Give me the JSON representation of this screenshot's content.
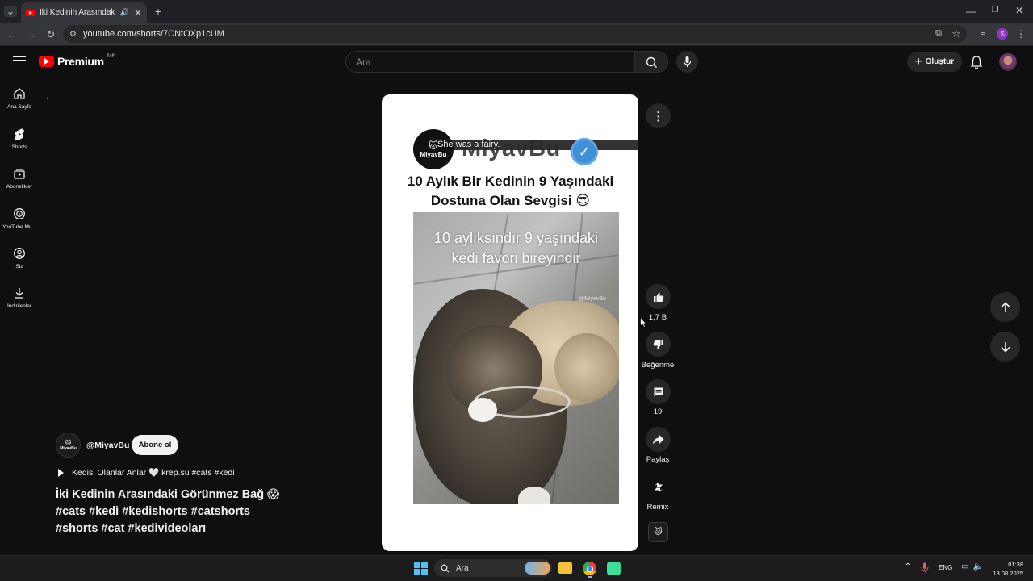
{
  "browser": {
    "tab_title": "İki Kedinin Arasındaki Görünmez Bağ",
    "url": "youtube.com/shorts/7CNtOXp1cUM",
    "profile_initial": "S"
  },
  "header": {
    "logo_text": "Premium",
    "logo_region": "MK",
    "search_placeholder": "Ara",
    "create_label": "Oluştur"
  },
  "sidebar": {
    "items": [
      {
        "label": "Ana Sayfa",
        "icon": "home-icon"
      },
      {
        "label": "Shorts",
        "icon": "shorts-icon"
      },
      {
        "label": "Abonelikler",
        "icon": "subscriptions-icon"
      },
      {
        "label": "YouTube Mu...",
        "icon": "youtube-music-icon"
      },
      {
        "label": "Siz",
        "icon": "you-icon"
      },
      {
        "label": "İndirilenler",
        "icon": "downloads-icon"
      }
    ]
  },
  "video": {
    "overlay_caption": "She was a fairy.",
    "channel_watermark": "MiyavBu",
    "avatar_text": "MiyavBu",
    "title_line1": "10 Aylık Bir Kedinin 9 Yaşındaki",
    "title_line2": "Dostuna Olan Sevgisi 😍",
    "frame_text_line1": "10 aylıksındır 9 yaşındaki",
    "frame_text_line2": "kedi favori bireyindir",
    "frame_mark": "@MiyavBu"
  },
  "actions": {
    "likes": "1,7 B",
    "dislike_label": "Beğenme",
    "comments": "19",
    "share_label": "Paylaş",
    "remix_label": "Remix"
  },
  "info": {
    "channel_handle": "@MiyavBu",
    "subscribe_label": "Abone ol",
    "music_text": "Kedisi Olanlar Anlar 🤍  krep.su  #cats #kedi",
    "description_line1": "İki Kedinin Arasındaki Görünmez Bağ 😱",
    "description_line2": "#cats #kedi #kedishorts #catshorts",
    "description_line3": "#shorts #cat #kedivideoları"
  },
  "taskbar": {
    "search_label": "Ara",
    "lang": "ENG",
    "time": "01:38",
    "date": "13.08.2025"
  },
  "colors": {
    "yt_red": "#ff0000",
    "background": "#0f0f0f",
    "verified_blue": "#3f8fd9"
  }
}
